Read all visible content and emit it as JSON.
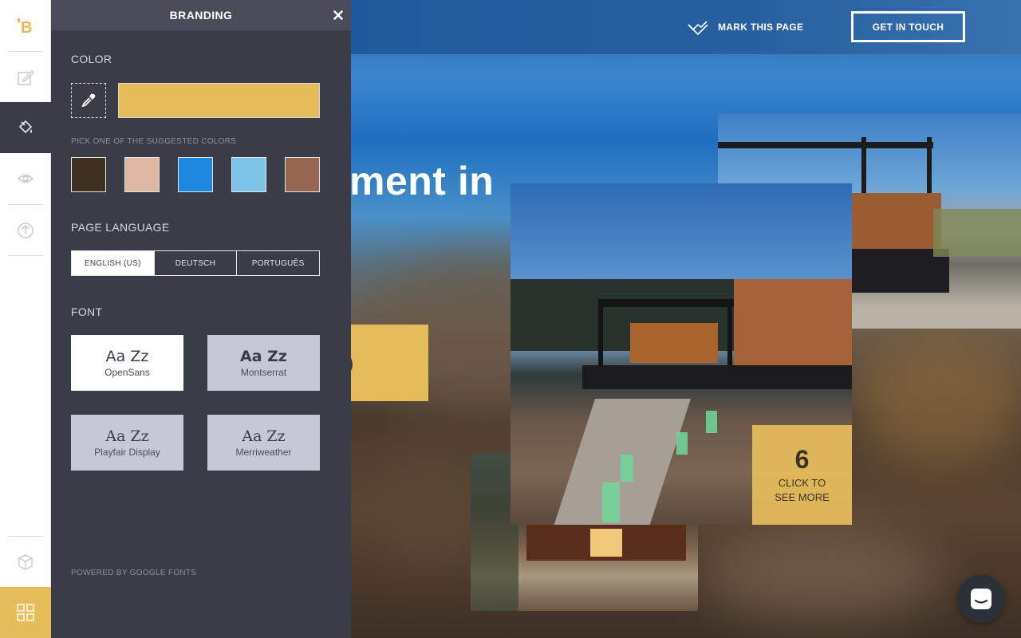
{
  "page": {
    "top_link_label": "MARK THIS PAGE",
    "cta_label": "GET IN TOUCH",
    "hero_text": "ment in",
    "gallery_counter": {
      "number": "6",
      "label_line1": "CLICK TO",
      "label_line2": "SEE MORE"
    }
  },
  "rail": {
    "logo_letter": "B",
    "items": [
      "logo",
      "edit-icon",
      "paint-bucket-icon",
      "eye-icon",
      "upload-icon",
      "cube-icon",
      "grid-icon"
    ]
  },
  "panel": {
    "title": "BRANDING",
    "color_section_title": "COLOR",
    "current_color": "#e6bc5a",
    "suggested_label": "PICK ONE OF THE SUGGESTED COLORS",
    "suggested_colors": [
      "#3f3022",
      "#deb8a4",
      "#1e88e0",
      "#7dc5e8",
      "#976650"
    ],
    "language_section_title": "PAGE LANGUAGE",
    "languages": [
      "ENGLISH (US)",
      "DEUTSCH",
      "PORTUGUÊS"
    ],
    "selected_language": "ENGLISH (US)",
    "font_section_title": "FONT",
    "fonts": [
      {
        "sample": "Aa Zz",
        "name": "OpenSans",
        "selected": true
      },
      {
        "sample": "Aa Zz",
        "name": "Montserrat",
        "selected": false
      },
      {
        "sample": "Aa Zz",
        "name": "Playfair Display",
        "selected": false
      },
      {
        "sample": "Aa Zz",
        "name": "Merriweather",
        "selected": false
      }
    ],
    "powered_by": "POWERED BY GOOGLE FONTS"
  },
  "colors": {
    "accent": "#e6bc5a",
    "panel_bg": "#3a3c48",
    "panel_header_bg": "#4a4c59"
  }
}
